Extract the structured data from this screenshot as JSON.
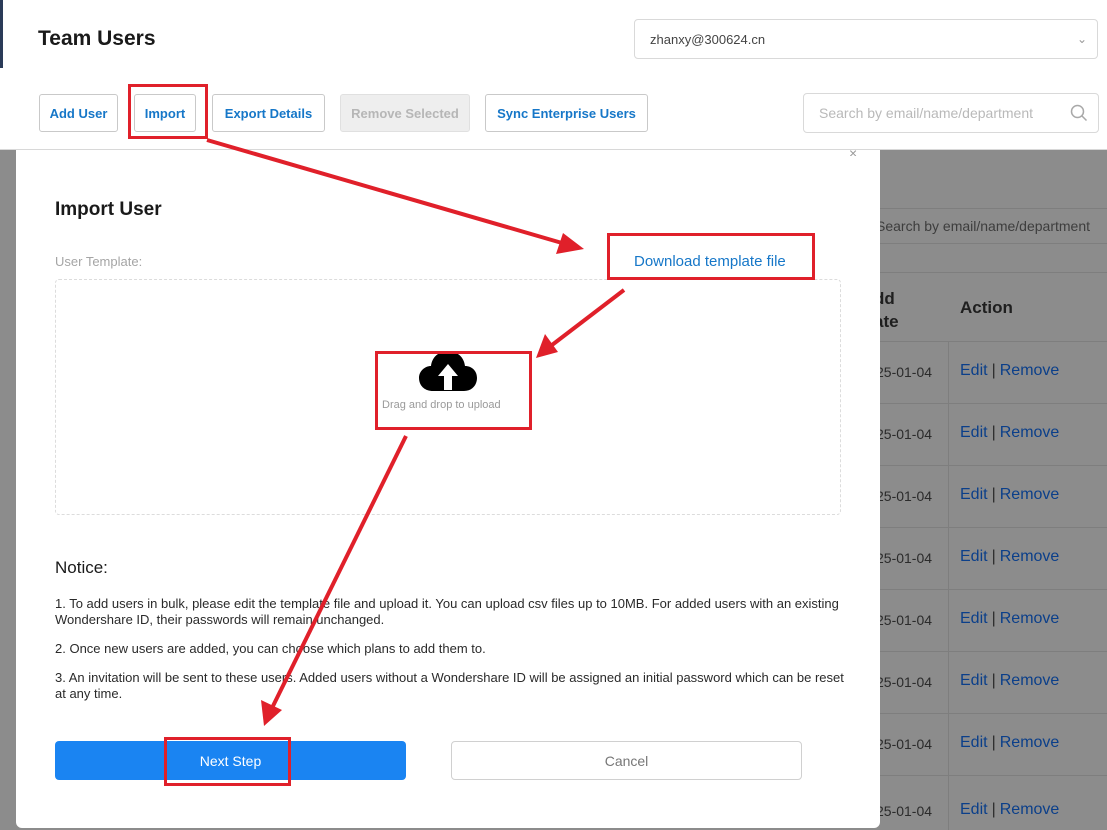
{
  "header": {
    "title": "Team Users",
    "account": "zhanxy@300624.cn"
  },
  "toolbar": {
    "add_user": "Add User",
    "import": "Import",
    "export_details": "Export Details",
    "remove_selected": "Remove Selected",
    "sync_enterprise": "Sync Enterprise Users",
    "search_placeholder": "Search by email/name/department"
  },
  "background_table": {
    "search_placeholder": "Search by email/name/department",
    "col_date": "dd\nate",
    "col_date_line1": "dd",
    "col_date_line2": "ate",
    "col_action": "Action",
    "rows": [
      {
        "date": "25-01-04",
        "edit": "Edit",
        "sep": "|",
        "remove": "Remove"
      },
      {
        "date": "25-01-04",
        "edit": "Edit",
        "sep": "|",
        "remove": "Remove"
      },
      {
        "date": "25-01-04",
        "edit": "Edit",
        "sep": "|",
        "remove": "Remove"
      },
      {
        "date": "25-01-04",
        "edit": "Edit",
        "sep": "|",
        "remove": "Remove"
      },
      {
        "date": "25-01-04",
        "edit": "Edit",
        "sep": "|",
        "remove": "Remove"
      },
      {
        "date": "25-01-04",
        "edit": "Edit",
        "sep": "|",
        "remove": "Remove"
      },
      {
        "date": "25-01-04",
        "edit": "Edit",
        "sep": "|",
        "remove": "Remove"
      },
      {
        "date": "25-01-04",
        "edit": "Edit",
        "sep": "|",
        "remove": "Remove"
      }
    ]
  },
  "modal": {
    "close": "×",
    "title": "Import User",
    "template_label": "User Template:",
    "download_link": "Download template file",
    "upload_text": "Drag and drop to upload",
    "notice_title": "Notice:",
    "notices": [
      "1. To add users in bulk, please edit the template file and upload it. You can upload csv files up to 10MB. For added users with an existing Wondershare ID, their passwords will remain unchanged.",
      "2. Once new users are added, you can choose which plans to add them to.",
      "3. An invitation will be sent to these users. Added users without a Wondershare ID will be assigned an initial password which can be reset at any time."
    ],
    "next_step": "Next Step",
    "cancel": "Cancel"
  },
  "colors": {
    "primary": "#1a84f2",
    "link": "#1677c8",
    "annotation": "#e0202a"
  }
}
